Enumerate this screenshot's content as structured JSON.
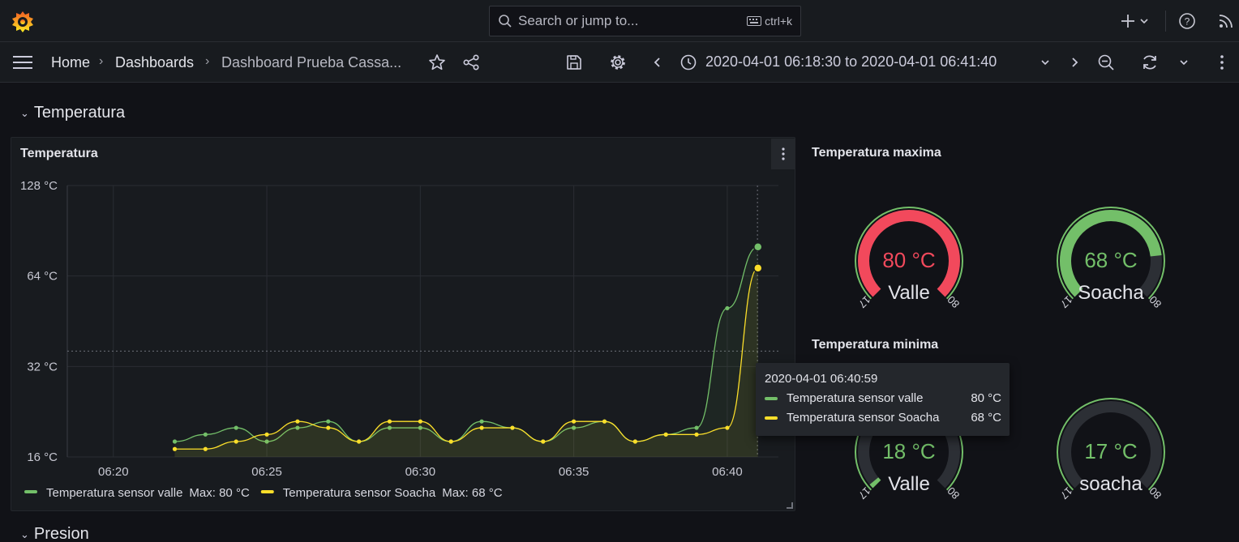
{
  "topbar": {
    "search_placeholder": "Search or jump to...",
    "shortcut": "ctrl+k",
    "icons": [
      "grafana-logo-icon",
      "search-icon",
      "keyboard-icon",
      "plus-icon",
      "chevron-down-icon",
      "help-icon",
      "rss-icon"
    ]
  },
  "navbar": {
    "breadcrumbs": [
      "Home",
      "Dashboards",
      "Dashboard Prueba Cassa..."
    ],
    "separator": "›",
    "time_range": "2020-04-01 06:18:30 to 2020-04-01 06:41:40",
    "icons": [
      "menu-icon",
      "star-icon",
      "share-icon",
      "save-icon",
      "settings-icon",
      "chevron-left-icon",
      "clock-icon",
      "chevron-down-icon",
      "chevron-right-icon",
      "zoom-out-icon",
      "refresh-icon",
      "chevron-down-icon",
      "kebab-menu-icon"
    ]
  },
  "rows": {
    "temperatura": "Temperatura",
    "presion": "Presion"
  },
  "timeseries_panel": {
    "title": "Temperatura",
    "legend": [
      {
        "name": "Temperatura sensor valle",
        "stat": "Max: 80 °C",
        "color": "#73bf69"
      },
      {
        "name": "Temperatura sensor Soacha",
        "stat": "Max: 68 °C",
        "color": "#fade2a"
      }
    ]
  },
  "chart_data": {
    "type": "line",
    "title": "Temperatura",
    "y_scale": "log2",
    "ylim": [
      16,
      128
    ],
    "yticks": [
      "16 °C",
      "32 °C",
      "64 °C",
      "128 °C"
    ],
    "xticks": [
      "06:20",
      "06:25",
      "06:30",
      "06:35",
      "06:40"
    ],
    "xlim": [
      "06:18:30",
      "06:41:40"
    ],
    "threshold_y": 36,
    "cursor_x": "06:40:59",
    "grid": true,
    "legend_position": "bottom-left",
    "x": [
      "06:22",
      "06:23",
      "06:24",
      "06:25",
      "06:26",
      "06:27",
      "06:28",
      "06:29",
      "06:30",
      "06:31",
      "06:32",
      "06:33",
      "06:34",
      "06:35",
      "06:36",
      "06:37",
      "06:38",
      "06:39",
      "06:40",
      "06:41"
    ],
    "series": [
      {
        "name": "Temperatura sensor valle",
        "color": "#73bf69",
        "values": [
          18,
          19,
          20,
          18,
          20,
          21,
          18,
          20,
          20,
          18,
          21,
          20,
          18,
          20,
          21,
          18,
          19,
          20,
          50,
          80
        ]
      },
      {
        "name": "Temperatura sensor Soacha",
        "color": "#fade2a",
        "values": [
          17,
          17,
          18,
          19,
          21,
          20,
          18,
          21,
          21,
          18,
          20,
          20,
          18,
          21,
          21,
          18,
          19,
          19,
          20,
          68
        ]
      }
    ]
  },
  "tooltip": {
    "time": "2020-04-01 06:40:59",
    "rows": [
      {
        "name": "Temperatura sensor valle",
        "value": "80 °C",
        "color": "#73bf69"
      },
      {
        "name": "Temperatura sensor Soacha",
        "value": "68 °C",
        "color": "#fade2a"
      }
    ]
  },
  "gauges": {
    "max_title": "Temperatura maxima",
    "min_title": "Temperatura minima",
    "min_label": "17",
    "max_label": "80",
    "items": [
      {
        "label": "Valle",
        "value": 80,
        "display": "80 °C",
        "color": "#f2495c"
      },
      {
        "label": "Soacha",
        "value": 68,
        "display": "68 °C",
        "color": "#73bf69"
      },
      {
        "label": "Valle",
        "value": 18,
        "display": "18 °C",
        "color": "#73bf69"
      },
      {
        "label": "soacha",
        "value": 17,
        "display": "17 °C",
        "color": "#73bf69"
      }
    ]
  }
}
